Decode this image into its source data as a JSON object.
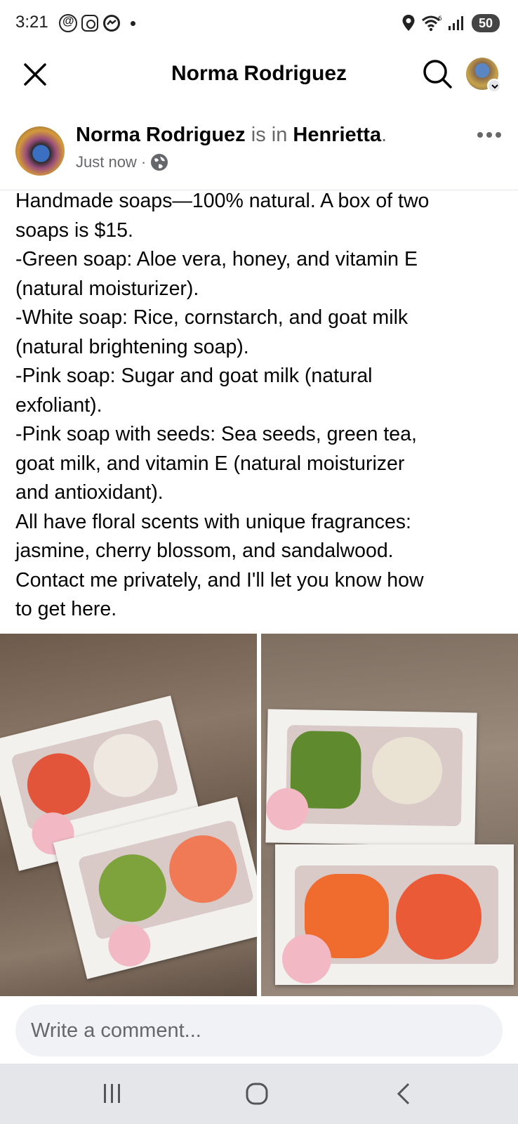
{
  "status_bar": {
    "time": "3:21",
    "battery": "50",
    "icons": [
      "threads-icon",
      "instagram-icon",
      "messenger-icon",
      "location-icon",
      "wifi-icon",
      "signal-icon"
    ]
  },
  "header": {
    "title": "Norma Rodriguez",
    "icons": [
      "close-icon",
      "search-icon",
      "profile-avatar"
    ]
  },
  "post": {
    "author": "Norma Rodriguez",
    "connector": " is in ",
    "location": "Henrietta",
    "period": ".",
    "time": "Just now",
    "separator": " · ",
    "privacy_icon": "globe-icon",
    "text_lines": [
      "Handmade soaps—100% natural. A box of two",
      "soaps is $15.",
      "-Green soap: Aloe vera, honey, and vitamin E",
      "(natural moisturizer).",
      "-White soap: Rice, cornstarch, and goat milk",
      "(natural brightening soap).",
      "-Pink soap: Sugar and goat milk (natural",
      "exfoliant).",
      "-Pink soap with seeds: Sea seeds, green tea,",
      "goat milk, and vitamin E (natural moisturizer",
      "and antioxidant).",
      "All have floral scents with unique fragrances:",
      "jasmine, cherry blossom, and sandalwood.",
      "Contact me privately, and I'll let you know how",
      "to get here."
    ]
  },
  "comment": {
    "placeholder": "Write a comment..."
  },
  "nav_bar": {
    "buttons": [
      "recent-apps-button",
      "home-button",
      "back-button"
    ]
  },
  "colors": {
    "text_primary": "#050505",
    "text_secondary": "#65676b",
    "comment_bg": "#f0f2f5",
    "nav_bg": "#e4e6ea"
  }
}
